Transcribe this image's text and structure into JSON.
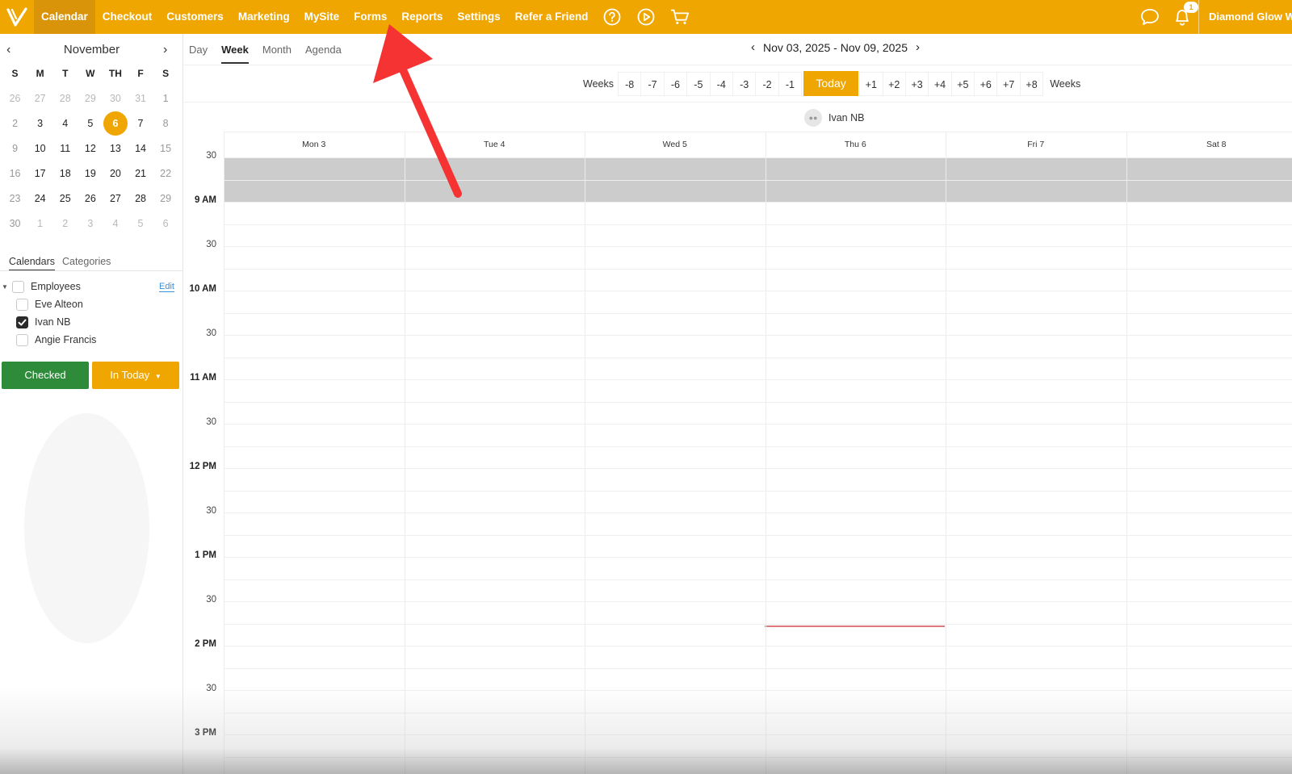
{
  "topbar": {
    "nav": [
      "Calendar",
      "Checkout",
      "Customers",
      "Marketing",
      "MySite",
      "Forms",
      "Reports",
      "Settings",
      "Refer a Friend"
    ],
    "active": "Calendar",
    "business_name": "Diamond Glow W",
    "notification_count": "1",
    "colors": {
      "brand": "#efa600",
      "brand_active": "#d9940a"
    }
  },
  "mini_calendar": {
    "month": "November",
    "weekday_heads": [
      "S",
      "M",
      "T",
      "W",
      "TH",
      "F",
      "S"
    ],
    "weeks": [
      [
        "26",
        "27",
        "28",
        "29",
        "30",
        "31",
        "1"
      ],
      [
        "2",
        "3",
        "4",
        "5",
        "6",
        "7",
        "8"
      ],
      [
        "9",
        "10",
        "11",
        "12",
        "13",
        "14",
        "15"
      ],
      [
        "16",
        "17",
        "18",
        "19",
        "20",
        "21",
        "22"
      ],
      [
        "23",
        "24",
        "25",
        "26",
        "27",
        "28",
        "29"
      ],
      [
        "30",
        "1",
        "2",
        "3",
        "4",
        "5",
        "6"
      ]
    ],
    "today": "6"
  },
  "sidebar": {
    "tabs": [
      "Calendars",
      "Categories"
    ],
    "group_label": "Employees",
    "edit_label": "Edit",
    "employees": [
      {
        "name": "Eve Alteon",
        "checked": false
      },
      {
        "name": "Ivan NB",
        "checked": true
      },
      {
        "name": "Angie Francis",
        "checked": false
      }
    ],
    "checked_button": "Checked",
    "in_today_button": "In Today"
  },
  "views": {
    "tabs": [
      "Day",
      "Week",
      "Month",
      "Agenda"
    ],
    "active": "Week"
  },
  "date_range": "Nov 03, 2025 - Nov 09, 2025",
  "weeks_nav": {
    "label": "Weeks",
    "minus": [
      "-8",
      "-7",
      "-6",
      "-5",
      "-4",
      "-3",
      "-2",
      "-1"
    ],
    "today": "Today",
    "plus": [
      "+1",
      "+2",
      "+3",
      "+4",
      "+5",
      "+6",
      "+7",
      "+8"
    ]
  },
  "resource_name": "Ivan NB",
  "days": [
    "Mon 3",
    "Tue 4",
    "Wed 5",
    "Thu 6",
    "Fri 7",
    "Sat 8"
  ],
  "time_labels": [
    "30",
    "9 AM",
    "30",
    "10 AM",
    "30",
    "11 AM",
    "30",
    "12 PM",
    "30",
    "1 PM",
    "30",
    "2 PM",
    "30",
    "3 PM"
  ]
}
